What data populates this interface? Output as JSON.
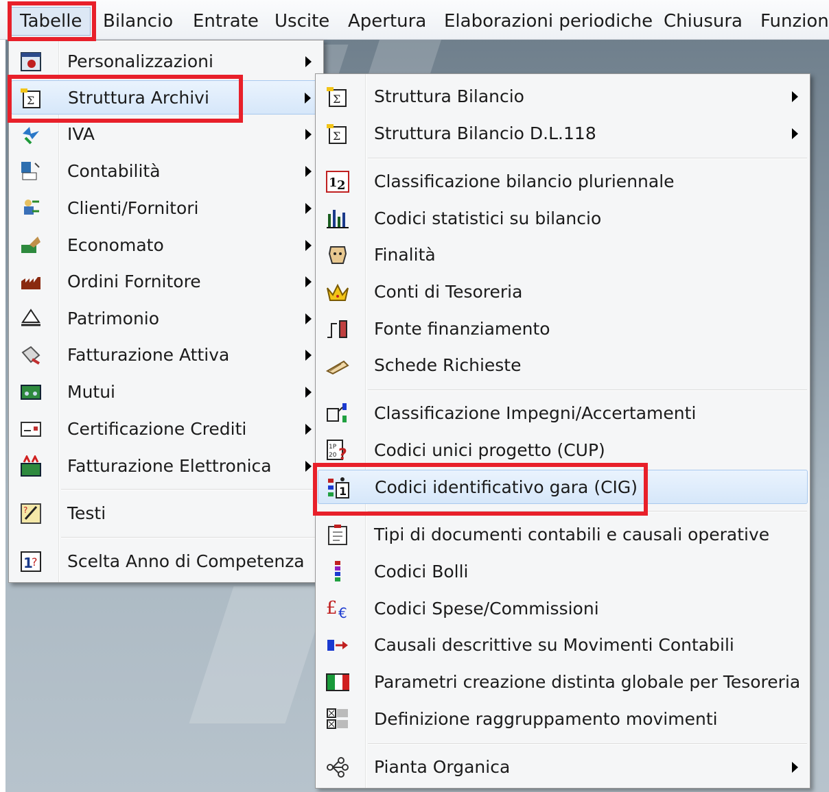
{
  "menubar": {
    "items": [
      "Tabelle",
      "Bilancio",
      "Entrate",
      "Uscite",
      "Apertura",
      "Elaborazioni periodiche",
      "Chiusura",
      "Funzion"
    ]
  },
  "menu1": {
    "items": [
      {
        "label": "Personalizzazioni",
        "icon": "personalizzazioni-icon",
        "submenu": true
      },
      {
        "label": "Struttura Archivi",
        "icon": "struttura-archivi-icon",
        "submenu": true,
        "highlighted": true
      },
      {
        "label": "IVA",
        "icon": "iva-icon",
        "submenu": true
      },
      {
        "label": "Contabilità",
        "icon": "contabilita-icon",
        "submenu": true
      },
      {
        "label": "Clienti/Fornitori",
        "icon": "clienti-fornitori-icon",
        "submenu": true
      },
      {
        "label": "Economato",
        "icon": "economato-icon",
        "submenu": true
      },
      {
        "label": "Ordini Fornitore",
        "icon": "ordini-fornitore-icon",
        "submenu": true
      },
      {
        "label": "Patrimonio",
        "icon": "patrimonio-icon",
        "submenu": true
      },
      {
        "label": "Fatturazione Attiva",
        "icon": "fatturazione-attiva-icon",
        "submenu": true
      },
      {
        "label": "Mutui",
        "icon": "mutui-icon",
        "submenu": true
      },
      {
        "label": "Certificazione Crediti",
        "icon": "certificazione-crediti-icon",
        "submenu": true
      },
      {
        "label": "Fatturazione Elettronica",
        "icon": "fatturazione-elettronica-icon",
        "submenu": true
      },
      {
        "label": "Testi",
        "icon": "testi-icon",
        "submenu": false
      },
      {
        "label": "Scelta Anno di Competenza",
        "icon": "scelta-anno-icon",
        "submenu": false
      }
    ]
  },
  "menu2": {
    "items": [
      {
        "label": "Struttura Bilancio",
        "icon": "struttura-bilancio-icon",
        "submenu": true
      },
      {
        "label": "Struttura Bilancio D.L.118",
        "icon": "struttura-bilancio-dl118-icon",
        "submenu": true
      },
      {
        "label": "Classificazione bilancio pluriennale",
        "icon": "classificazione-pluriennale-icon",
        "submenu": false
      },
      {
        "label": "Codici statistici su bilancio",
        "icon": "codici-statistici-icon",
        "submenu": false
      },
      {
        "label": "Finalità",
        "icon": "finalita-icon",
        "submenu": false
      },
      {
        "label": "Conti di Tesoreria",
        "icon": "crown-icon",
        "submenu": false
      },
      {
        "label": "Fonte finanziamento",
        "icon": "fonte-finanziamento-icon",
        "submenu": false
      },
      {
        "label": "Schede Richieste",
        "icon": "schede-richieste-icon",
        "submenu": false
      },
      {
        "label": "Classificazione Impegni/Accertamenti",
        "icon": "classificazione-impegni-icon",
        "submenu": false
      },
      {
        "label": "Codici unici progetto (CUP)",
        "icon": "cup-icon",
        "submenu": false
      },
      {
        "label": "Codici identificativo gara (CIG)",
        "icon": "cig-icon",
        "submenu": false,
        "highlighted": true
      },
      {
        "label": "Tipi di documenti contabili e causali operative",
        "icon": "tipi-documenti-icon",
        "submenu": false
      },
      {
        "label": "Codici Bolli",
        "icon": "codici-bolli-icon",
        "submenu": false
      },
      {
        "label": "Codici Spese/Commissioni",
        "icon": "spese-commissioni-icon",
        "submenu": false
      },
      {
        "label": "Causali descrittive su Movimenti Contabili",
        "icon": "causali-descrittive-icon",
        "submenu": false
      },
      {
        "label": "Parametri creazione distinta globale per Tesoreria",
        "icon": "parametri-distinta-icon",
        "submenu": false
      },
      {
        "label": "Definizione raggruppamento movimenti",
        "icon": "raggruppamento-icon",
        "submenu": false
      },
      {
        "label": "Pianta Organica",
        "icon": "pianta-organica-icon",
        "submenu": true
      }
    ]
  },
  "colors": {
    "annotation_red": "#e8202a",
    "highlight_blue": "#d6e7fa"
  }
}
